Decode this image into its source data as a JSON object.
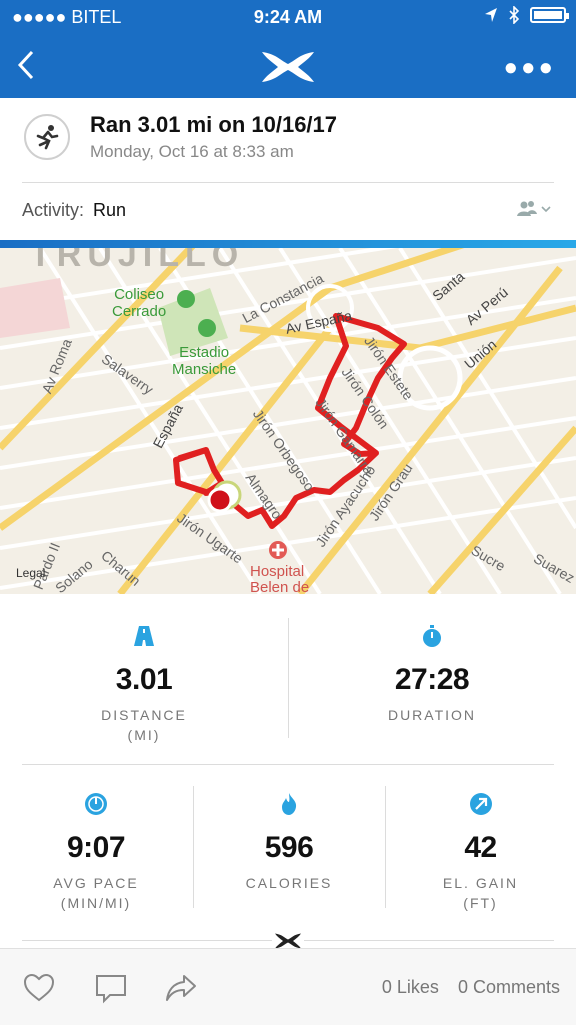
{
  "status_bar": {
    "carrier": "●●●●● BITEL",
    "time": "9:24 AM"
  },
  "workout": {
    "title": "Ran 3.01 mi on 10/16/17",
    "subtitle": "Monday, Oct 16 at 8:33 am"
  },
  "activity": {
    "label": "Activity:",
    "value": "Run"
  },
  "map": {
    "labels": {
      "coliseo": "Coliseo\nCerrado",
      "estadio": "Estadio\nMansiche",
      "la_constancia": "La Constancia",
      "av_espana_top": "Av España",
      "av_roma": "Av Roma",
      "salaverry": "Salaverry",
      "espana": "España",
      "jiron_estete": "Jirón Estete",
      "jiron_colon": "Jirón Colón",
      "jiron_gamarra": "Jirón Gamarra",
      "jiron_orbegoso": "Jirón Orbegoso",
      "jiron_almagro": "Almagro",
      "jiron_ayacucho": "Jirón Ayacucho",
      "jiron_grau": "Jirón Grau",
      "jiron_ugarte": "Jirón Ugarte",
      "santa": "Santa",
      "av_peru": "Av Perú",
      "union": "Unión",
      "sucre": "Sucre",
      "suarez": "Suarez",
      "charun": "Charun",
      "solano": "Solano",
      "pardo": "Pardo II",
      "legal": "Legal",
      "hospital": "Hospital\nBelen de",
      "trujillo": "TRUJILLO"
    }
  },
  "stats": {
    "distance": {
      "value": "3.01",
      "label": "DISTANCE",
      "unit": "(MI)"
    },
    "duration": {
      "value": "27:28",
      "label": "DURATION"
    },
    "avg_pace": {
      "value": "9:07",
      "label": "AVG PACE",
      "unit": "(MIN/MI)"
    },
    "calories": {
      "value": "596",
      "label": "CALORIES"
    },
    "el_gain": {
      "value": "42",
      "label": "EL. GAIN",
      "unit": "(FT)"
    }
  },
  "social": {
    "likes": "0 Likes",
    "comments": "0 Comments"
  },
  "colors": {
    "brand_blue": "#1a6ec4",
    "route_red": "#e02020",
    "icon_blue": "#2aa3e0"
  }
}
